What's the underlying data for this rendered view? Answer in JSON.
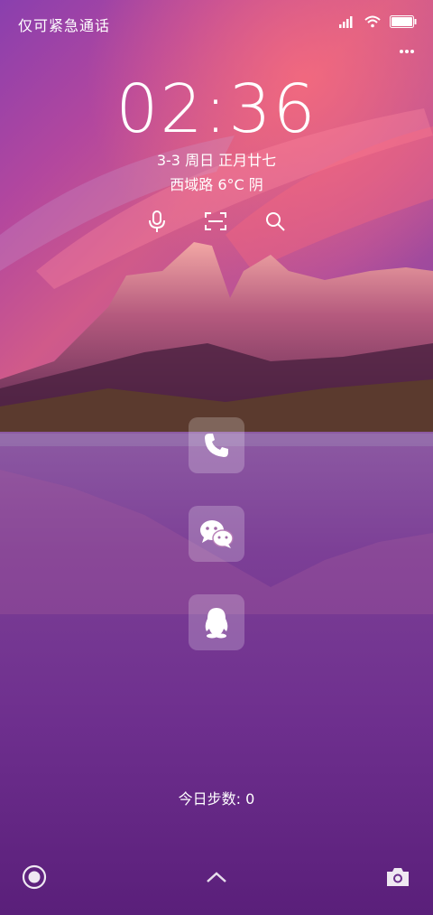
{
  "status_bar": {
    "carrier_text": "仅可紧急通话",
    "icons": [
      "signal-icon",
      "wifi-icon",
      "battery-icon"
    ]
  },
  "lockscreen": {
    "time": "02:36",
    "date": "3-3 周日 正月廿七",
    "weather": "西域路 6°C 阴",
    "quick_actions": [
      "microphone-icon",
      "scan-icon",
      "search-icon"
    ],
    "apps": [
      "phone-icon",
      "wechat-icon",
      "qq-icon"
    ],
    "steps": "今日步数: 0",
    "bottom": [
      "assistant-icon",
      "chevron-up-icon",
      "camera-icon"
    ]
  }
}
